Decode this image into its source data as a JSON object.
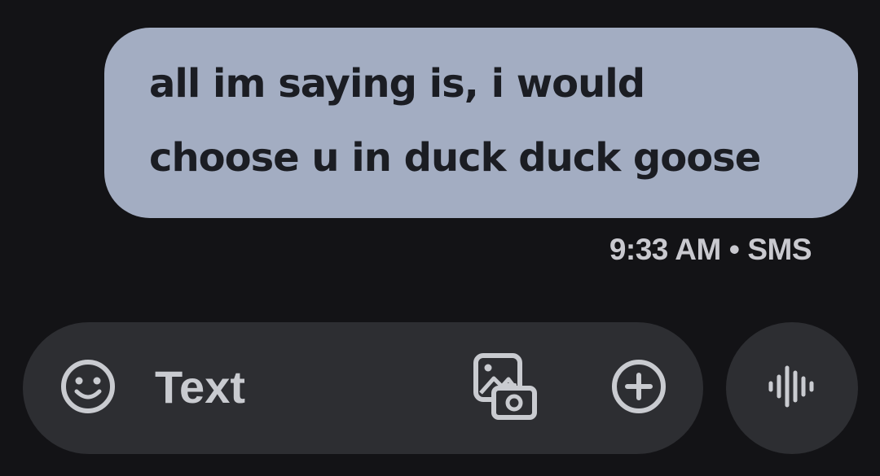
{
  "message": {
    "text": "all im saying is, i would\nchoose u in duck duck goose",
    "time": "9:33 AM",
    "separator": "•",
    "channel": "SMS"
  },
  "composer": {
    "placeholder": "Text",
    "icons": [
      "emoji-icon",
      "gallery-camera-icon",
      "add-icon",
      "voice-waveform-icon"
    ]
  },
  "colors": {
    "background": "#131316",
    "bubble": "#a3adc2",
    "bubble_text": "#1b1d23",
    "composer": "#2d2e32",
    "icon": "#c9cbd0"
  }
}
